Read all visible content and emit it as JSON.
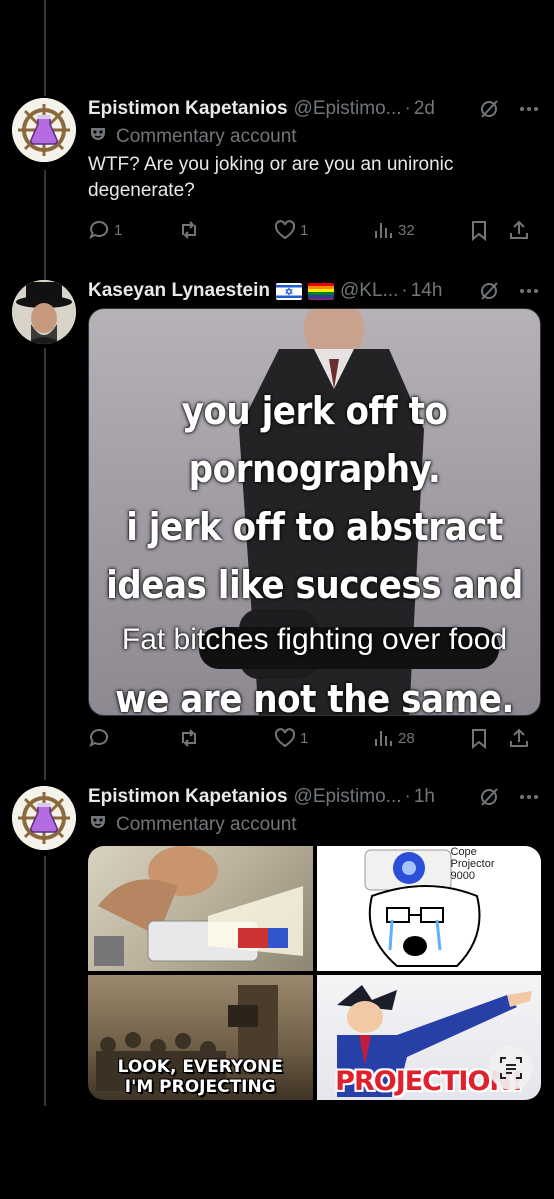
{
  "tweets": [
    {
      "name": "Epistimon Kapetanios",
      "handle": "@Epistimo...",
      "time": "2d",
      "label": "Commentary account",
      "text": "WTF? Are you joking or are you an unironic degenerate?",
      "replies": "1",
      "likes": "1",
      "views": "32"
    },
    {
      "name": "Kaseyan Lynaestein",
      "handle": "@KL...",
      "time": "14h",
      "replies": "",
      "likes": "1",
      "views": "28",
      "meme_lines": [
        "you jerk off to",
        "pornography.",
        "i jerk off to abstract",
        "ideas like success and",
        "Fat bitches fighting over food",
        "we are not the same."
      ]
    },
    {
      "name": "Epistimon Kapetanios",
      "handle": "@Epistimo...",
      "time": "1h",
      "label": "Commentary account",
      "grid": {
        "projector_caption": "Cope\nProjector\n9000",
        "bottom_left_caption": "LOOK, EVERYONE\nI'M PROJECTING",
        "bottom_right_caption": "PROJECTION!"
      }
    }
  ],
  "separator": "·",
  "colors": {
    "background": "#000000",
    "text": "#e7e9ea",
    "secondary": "#71767b"
  }
}
